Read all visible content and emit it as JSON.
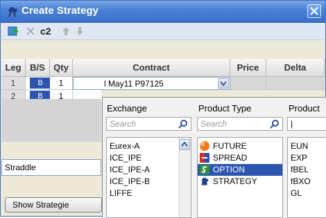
{
  "window": {
    "title": "Create Strategy"
  },
  "toolbar": {
    "icons": [
      "add-leg-icon",
      "delete-icon",
      "c2-icon",
      "move-up-icon",
      "move-down-icon"
    ],
    "c2_label": "c2"
  },
  "grid": {
    "headers": {
      "leg": "Leg",
      "bs": "B/S",
      "qty": "Qty",
      "contract": "Contract",
      "price": "Price",
      "delta": "Delta"
    },
    "rows": [
      {
        "leg": "1",
        "bs": "B",
        "qty": "1",
        "contract": "l May11 P97125"
      },
      {
        "leg": "2",
        "bs": "B",
        "qty": "1",
        "contract": ""
      }
    ]
  },
  "strategy_type": "Straddle",
  "show_strategies_button": "Show Strategie",
  "popup": {
    "exchange": {
      "header": "Exchange",
      "search_placeholder": "Search",
      "items": [
        "Eurex-A",
        "ICE_IPE",
        "ICE_IPE-A",
        "ICE_IPE-B",
        "LIFFE"
      ]
    },
    "product_type": {
      "header": "Product Type",
      "search_placeholder": "Search",
      "items": [
        "FUTURE",
        "SPREAD",
        "OPTION",
        "STRATEGY"
      ],
      "selected": "OPTION"
    },
    "product": {
      "header": "Product",
      "search_value": "|",
      "items": [
        "EUN",
        "EXP",
        "fBEL",
        "fBXO",
        "GL"
      ]
    }
  },
  "colors": {
    "selection": "#2c55b0",
    "title_bar": "#3a6fc7"
  }
}
